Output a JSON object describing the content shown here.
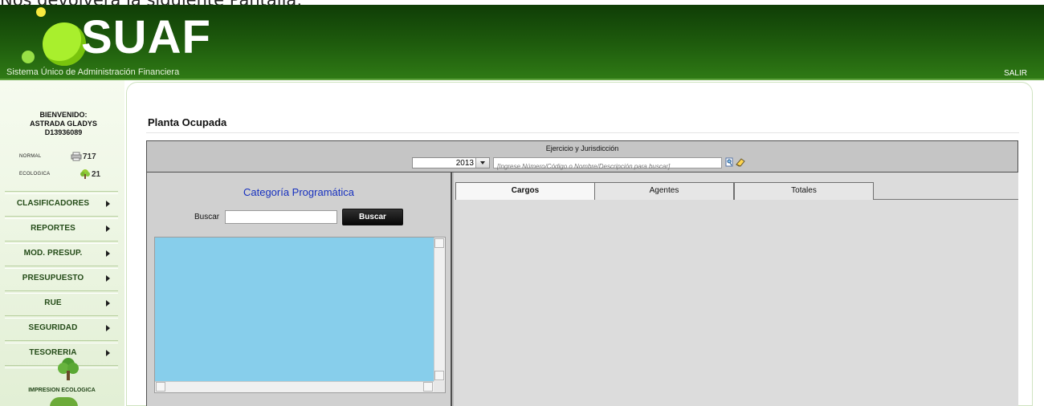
{
  "top_caption": "Nos devolverá la siguiente Pantalla:",
  "header": {
    "logo_text": "SUAF",
    "subtitle": "Sistema Único de Administración Financiera",
    "exit_label": "SALIR"
  },
  "sidebar": {
    "welcome_line1": "BIENVENIDO:",
    "welcome_line2": "ASTRADA GLADYS",
    "welcome_line3": "D13936089",
    "normal_label": "NORMAL",
    "normal_count": "717",
    "eco_label": "ECOLOGICA",
    "eco_count": "21",
    "items": [
      {
        "label": "CLASIFICADORES"
      },
      {
        "label": "REPORTES"
      },
      {
        "label": "MOD. PRESUP."
      },
      {
        "label": "PRESUPUESTO"
      },
      {
        "label": "RUE"
      },
      {
        "label": "SEGURIDAD"
      },
      {
        "label": "TESORERIA"
      }
    ],
    "eco_print_label": "IMPRESION ECOLOGICA"
  },
  "page": {
    "title": "Planta Ocupada",
    "filter_title": "Ejercicio y Jurisdicción",
    "year": "2013",
    "search_placeholder": "[Ingrese Número/Código o Nombre/Descripción para buscar]"
  },
  "left_panel": {
    "title": "Categoría Programática",
    "search_label": "Buscar",
    "search_button": "Buscar"
  },
  "tabs": [
    {
      "label": "Cargos",
      "active": true
    },
    {
      "label": "Agentes",
      "active": false
    },
    {
      "label": "Totales",
      "active": false
    }
  ],
  "colors": {
    "header_green": "#1f5d0d",
    "content_gray": "#c5c5c5",
    "tree_blue": "#87ceeb",
    "title_blue": "#1630bf"
  }
}
